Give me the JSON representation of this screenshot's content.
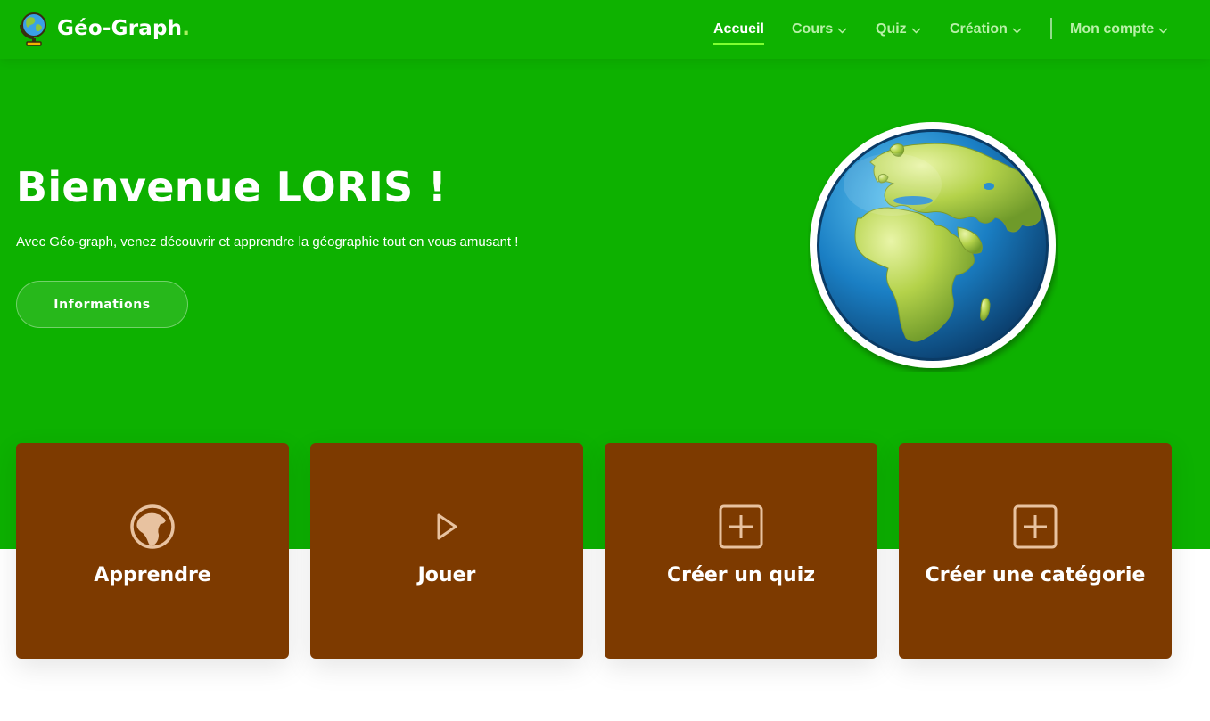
{
  "brand": {
    "name": "Géo-Graph",
    "dot": ".",
    "logo_icon": "globe-icon"
  },
  "nav": {
    "items": [
      {
        "label": "Accueil",
        "active": true
      },
      {
        "label": "Cours",
        "dropdown": true
      },
      {
        "label": "Quiz",
        "dropdown": true
      },
      {
        "label": "Création",
        "dropdown": true
      },
      {
        "label": "Mon compte",
        "dropdown": true
      }
    ]
  },
  "hero": {
    "title": "Bienvenue LORIS !",
    "subtitle": "Avec Géo-graph, venez découvrir et apprendre la géographie tout en vous amusant !",
    "button_label": "Informations",
    "image_icon": "earth-globe-icon"
  },
  "cards": [
    {
      "label": "Apprendre",
      "icon": "africa-globe-icon"
    },
    {
      "label": "Jouer",
      "icon": "play-icon"
    },
    {
      "label": "Créer un quiz",
      "icon": "plus-square-icon"
    },
    {
      "label": "Créer une catégorie",
      "icon": "plus-square-icon"
    }
  ],
  "colors": {
    "primary_green": "#0db100",
    "nav_active_underline": "#7fff30",
    "card_brown": "#7d3a00",
    "card_icon": "#e8c2a0"
  }
}
